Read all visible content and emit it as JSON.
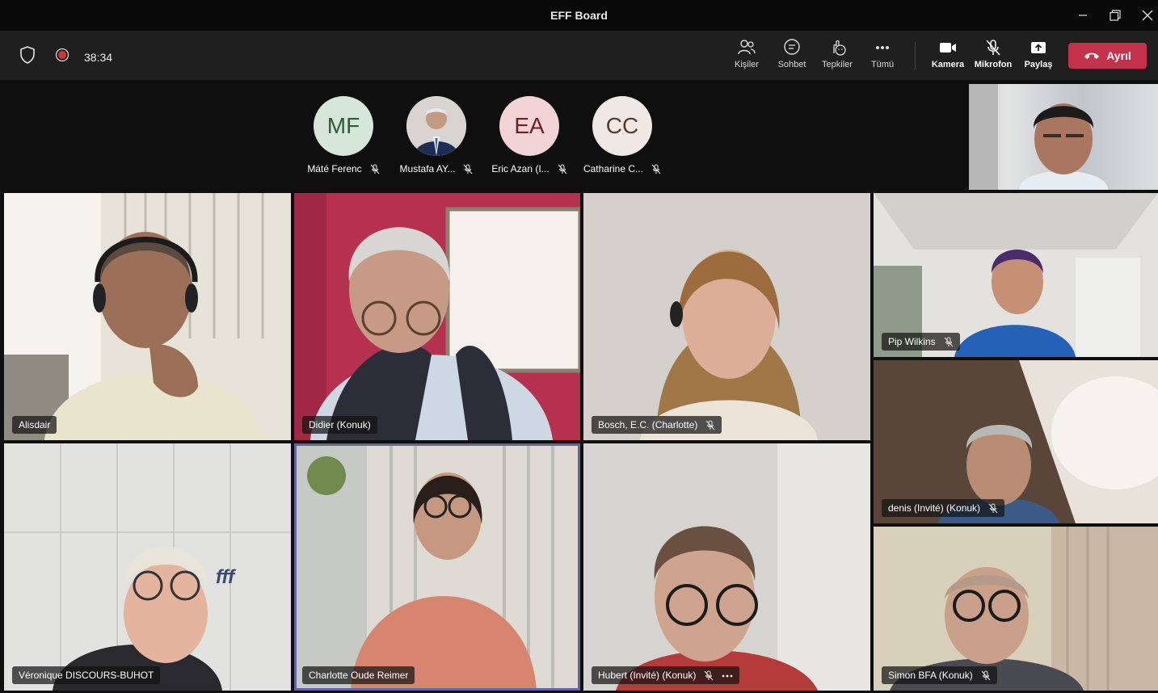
{
  "window": {
    "title": "EFF Board"
  },
  "toolbar": {
    "timer": "38:34",
    "items": [
      {
        "label": "Kişiler",
        "icon": "people-icon"
      },
      {
        "label": "Sohbet",
        "icon": "chat-icon"
      },
      {
        "label": "Tepkiler",
        "icon": "reactions-icon"
      },
      {
        "label": "Tümü",
        "icon": "more-icon"
      },
      {
        "label": "Kamera",
        "icon": "camera-icon"
      },
      {
        "label": "Mikrofon",
        "icon": "mic-off-icon"
      },
      {
        "label": "Paylaş",
        "icon": "share-icon"
      }
    ],
    "leave_label": "Ayrıl",
    "leave_color": "#c4314b"
  },
  "strip": {
    "participants": [
      {
        "initials": "MF",
        "name": "Máté Ferenc",
        "bg": "#d6e7da",
        "fg": "#2f5a3c",
        "muted": true
      },
      {
        "initials": "",
        "name": "Mustafa AY...",
        "bg": "#3b4f7a",
        "fg": "#ffffff",
        "muted": true,
        "photo": true
      },
      {
        "initials": "EA",
        "name": "Eric Azan (I...",
        "bg": "#f2d4d7",
        "fg": "#6b1f2a",
        "muted": true
      },
      {
        "initials": "CC",
        "name": "Catharine C...",
        "bg": "#f0e8e4",
        "fg": "#5a3a2f",
        "muted": true
      }
    ]
  },
  "grid": {
    "tiles": [
      {
        "name": "Alisdair",
        "muted": false
      },
      {
        "name": "Didier (Konuk)",
        "muted": false
      },
      {
        "name": "Bosch, E.C. (Charlotte)",
        "muted": true
      },
      {
        "name": "Pip Wilkins",
        "muted": true
      },
      {
        "name": "denis (Invité) (Konuk)",
        "muted": true
      },
      {
        "name": "Véronique DISCOURS-BUHOT",
        "muted": false
      },
      {
        "name": "Charlotte Oude Reimer",
        "muted": false,
        "active": true
      },
      {
        "name": "Hubert (Invité) (Konuk)",
        "muted": true,
        "more": true
      },
      {
        "name": "Simon BFA (Konuk)",
        "muted": true
      }
    ]
  },
  "logo_text": "fff"
}
